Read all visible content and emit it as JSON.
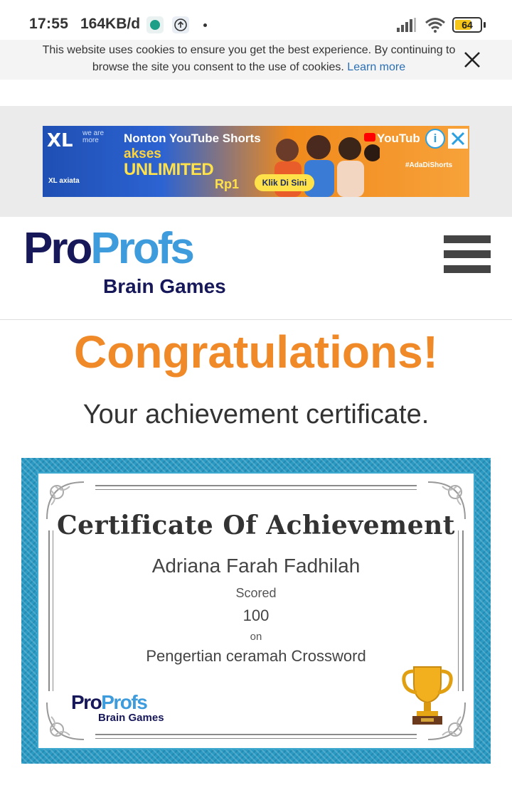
{
  "status_bar": {
    "time": "17:55",
    "data_speed": "164KB/d",
    "battery_level": "64",
    "battery_color": "#f5c518"
  },
  "cookie_bar": {
    "message": "This website uses cookies to ensure you get the best experience. By continuing to browse the site you consent to the use of cookies.",
    "link_label": "Learn more",
    "close_icon": "close-icon"
  },
  "ad": {
    "brand": "XL",
    "brand_tagline": "we are more",
    "brand_sub": "XL axiata",
    "headline": "Nonton YouTube Shorts",
    "line2": "akses",
    "line3": "UNLIMITED",
    "price": "Rp1",
    "cta": "Klik Di Sini",
    "youtube_label": "YouTub",
    "hashtag": "#AdaDiShorts",
    "info_icon": "info-icon",
    "close_icon": "close-icon"
  },
  "header": {
    "logo_pro": "Pro",
    "logo_profs": "Profs",
    "logo_sub": "Brain Games",
    "menu_icon": "hamburger-menu-icon"
  },
  "main": {
    "heading": "Congratulations!",
    "subheading": "Your achievement certificate."
  },
  "certificate": {
    "title": "Certificate Of Achievement",
    "recipient": "Adriana Farah Fadhilah",
    "scored_label": "Scored",
    "score": "100",
    "on_label": "on",
    "quiz_name": "Pengertian ceramah Crossword",
    "logo_pro": "Pro",
    "logo_profs": "Profs",
    "logo_sub": "Brain Games",
    "trophy_icon": "trophy-icon"
  },
  "colors": {
    "accent_orange": "#f08a28",
    "brand_navy": "#17185a",
    "brand_blue": "#3e9bdc",
    "frame_blue": "#2b9bc4",
    "link_blue": "#2a6fb4"
  }
}
